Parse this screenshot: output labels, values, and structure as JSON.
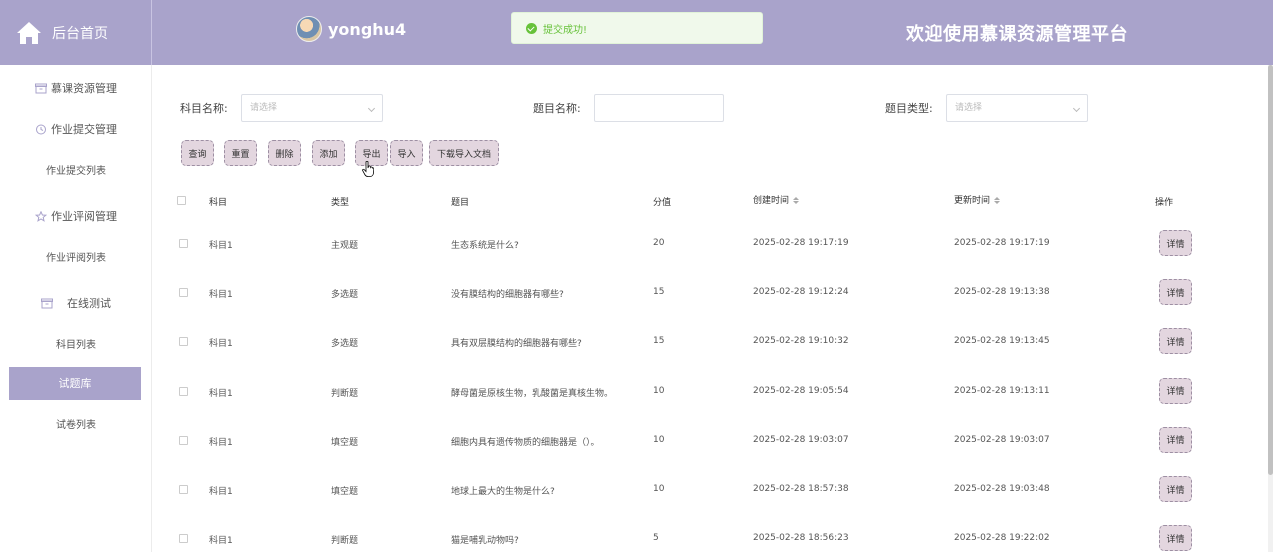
{
  "header": {
    "home_label": "后台首页",
    "username": "yonghu4",
    "platform_title": "欢迎使用慕课资源管理平台",
    "toast": "提交成功!"
  },
  "sidebar": {
    "items": [
      {
        "label": "慕课资源管理",
        "icon": "box-icon",
        "type": "group"
      },
      {
        "label": "作业提交管理",
        "icon": "clock-icon",
        "type": "group"
      },
      {
        "label": "作业提交列表",
        "type": "sub"
      },
      {
        "label": "作业评阅管理",
        "icon": "star-icon",
        "type": "group"
      },
      {
        "label": "作业评阅列表",
        "type": "sub"
      },
      {
        "label": "在线测试",
        "icon": "box-icon",
        "type": "group"
      },
      {
        "label": "科目列表",
        "type": "sub"
      },
      {
        "label": "试题库",
        "type": "sub",
        "active": true
      },
      {
        "label": "试卷列表",
        "type": "sub"
      }
    ]
  },
  "filters": {
    "subject_label": "科目名称:",
    "subject_placeholder": "请选择",
    "title_label": "题目名称:",
    "title_value": "",
    "type_label": "题目类型:",
    "type_placeholder": "请选择"
  },
  "toolbar": {
    "query": "查询",
    "reset": "重置",
    "delete": "删除",
    "add": "添加",
    "export": "导出",
    "import": "导入",
    "download_template": "下载导入文档"
  },
  "table": {
    "headers": [
      "科目",
      "类型",
      "题目",
      "分值",
      "创建时间",
      "更新时间",
      "操作"
    ],
    "detail_label": "详情",
    "rows": [
      {
        "subject": "科目1",
        "type": "主观题",
        "question": "生态系统是什么?",
        "score": "20",
        "created": "2025-02-28 19:17:19",
        "updated": "2025-02-28 19:17:19"
      },
      {
        "subject": "科目1",
        "type": "多选题",
        "question": "没有膜结构的细胞器有哪些?",
        "score": "15",
        "created": "2025-02-28 19:12:24",
        "updated": "2025-02-28 19:13:38"
      },
      {
        "subject": "科目1",
        "type": "多选题",
        "question": "具有双层膜结构的细胞器有哪些?",
        "score": "15",
        "created": "2025-02-28 19:10:32",
        "updated": "2025-02-28 19:13:45"
      },
      {
        "subject": "科目1",
        "type": "判断题",
        "question": "酵母菌是原核生物，乳酸菌是真核生物。",
        "score": "10",
        "created": "2025-02-28 19:05:54",
        "updated": "2025-02-28 19:13:11"
      },
      {
        "subject": "科目1",
        "type": "填空题",
        "question": "细胞内具有遗传物质的细胞器是（）。",
        "score": "10",
        "created": "2025-02-28 19:03:07",
        "updated": "2025-02-28 19:03:07"
      },
      {
        "subject": "科目1",
        "type": "填空题",
        "question": "地球上最大的生物是什么?",
        "score": "10",
        "created": "2025-02-28 18:57:38",
        "updated": "2025-02-28 19:03:48"
      },
      {
        "subject": "科目1",
        "type": "判断题",
        "question": "猫是哺乳动物吗?",
        "score": "5",
        "created": "2025-02-28 18:56:23",
        "updated": "2025-02-28 19:22:02"
      }
    ]
  }
}
